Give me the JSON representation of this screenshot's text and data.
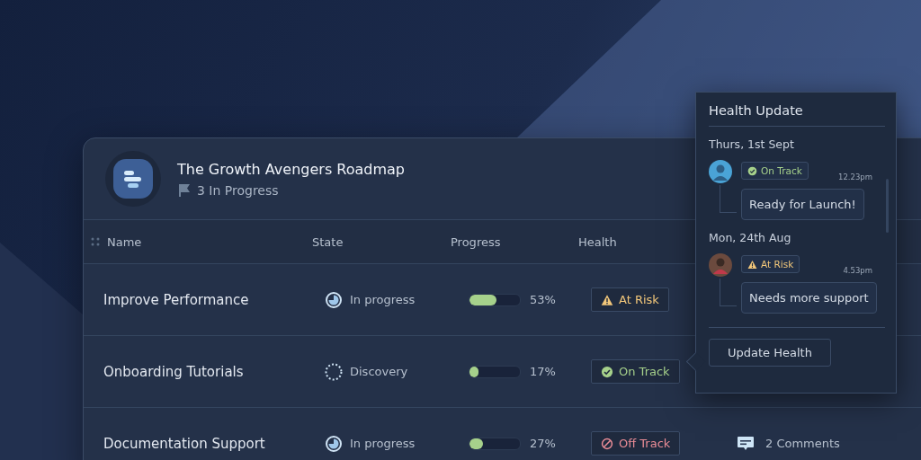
{
  "roadmap": {
    "title": "The Growth Avengers Roadmap",
    "status": "3 In Progress"
  },
  "table": {
    "columns": [
      "Name",
      "State",
      "Progress",
      "Health"
    ],
    "rows": [
      {
        "name": "Improve Performance",
        "state": {
          "kind": "in_progress",
          "label": "In progress"
        },
        "level": 0.53,
        "percent": "53%",
        "health": {
          "kind": "at_risk",
          "label": "At Risk"
        }
      },
      {
        "name": "Onboarding Tutorials",
        "state": {
          "kind": "discovery",
          "label": "Discovery"
        },
        "level": 0.17,
        "percent": "17%",
        "health": {
          "kind": "on_track",
          "label": "On Track"
        }
      },
      {
        "name": "Documentation Support",
        "state": {
          "kind": "in_progress",
          "label": "In progress"
        },
        "level": 0.27,
        "percent": "27%",
        "health": {
          "kind": "off_track",
          "label": "Off Track"
        },
        "comments": "2 Comments"
      }
    ]
  },
  "health_update": {
    "title": "Health Update",
    "entries": [
      {
        "date": "Thurs, 1st Sept",
        "health": {
          "kind": "on_track",
          "label": "On Track"
        },
        "time": "12.23pm",
        "message": "Ready for Launch!"
      },
      {
        "date": "Mon, 24th Aug",
        "health": {
          "kind": "at_risk",
          "label": "At Risk"
        },
        "time": "4.53pm",
        "message": "Needs more support"
      }
    ],
    "button": "Update Health"
  }
}
